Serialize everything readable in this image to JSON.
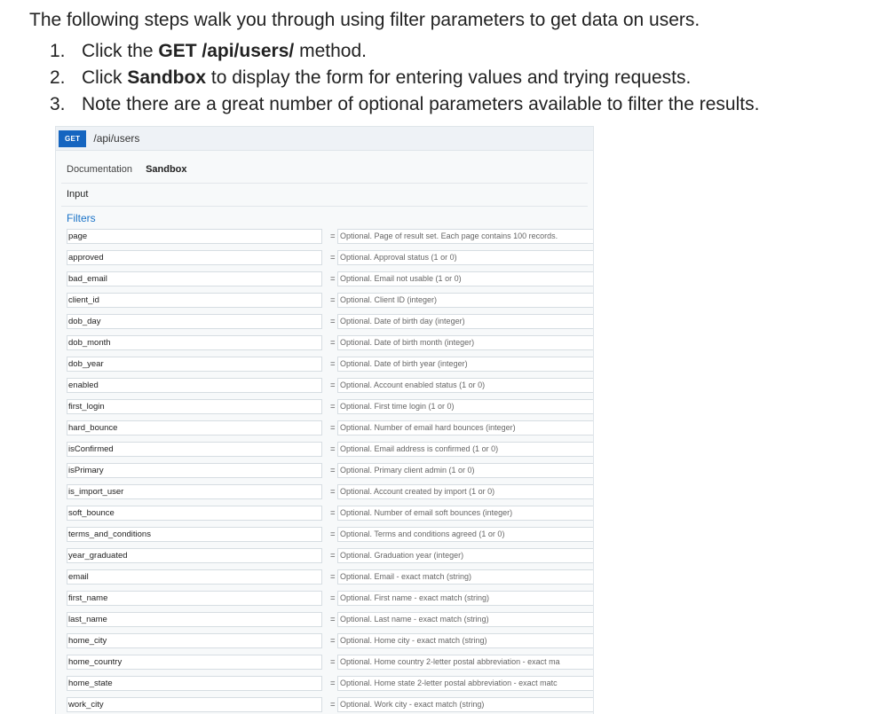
{
  "intro": "The following steps walk you through using filter parameters to get data on users.",
  "steps": [
    {
      "num": "1.",
      "pre": "Click the ",
      "bold": "GET /api/users/",
      "post": " method."
    },
    {
      "num": "2.",
      "pre": "Click ",
      "bold": "Sandbox",
      "post": " to display the form for entering values and trying requests."
    },
    {
      "num": "3.",
      "pre": "Note there are a great number of optional parameters available to filter the results.",
      "bold": "",
      "post": ""
    }
  ],
  "panel": {
    "method": "GET",
    "path": "/api/users",
    "tabs": [
      "Documentation",
      "Sandbox"
    ],
    "input_label": "Input",
    "filters_label": "Filters",
    "eq": "=",
    "dash": "-"
  },
  "filters": [
    {
      "name": "page",
      "desc": "Optional. Page of result set. Each page contains 100 records."
    },
    {
      "name": "approved",
      "desc": "Optional. Approval status (1 or 0)"
    },
    {
      "name": "bad_email",
      "desc": "Optional. Email not usable (1 or 0)"
    },
    {
      "name": "client_id",
      "desc": "Optional. Client ID (integer)"
    },
    {
      "name": "dob_day",
      "desc": "Optional. Date of birth day (integer)"
    },
    {
      "name": "dob_month",
      "desc": "Optional. Date of birth month (integer)"
    },
    {
      "name": "dob_year",
      "desc": "Optional. Date of birth year (integer)"
    },
    {
      "name": "enabled",
      "desc": "Optional. Account enabled status (1 or 0)"
    },
    {
      "name": "first_login",
      "desc": "Optional. First time login (1 or 0)"
    },
    {
      "name": "hard_bounce",
      "desc": "Optional. Number of email hard bounces (integer)"
    },
    {
      "name": "isConfirmed",
      "desc": "Optional. Email address is confirmed (1 or 0)"
    },
    {
      "name": "isPrimary",
      "desc": "Optional. Primary client admin (1 or 0)"
    },
    {
      "name": "is_import_user",
      "desc": "Optional. Account created by import (1 or 0)"
    },
    {
      "name": "soft_bounce",
      "desc": "Optional. Number of email soft bounces (integer)"
    },
    {
      "name": "terms_and_conditions",
      "desc": "Optional. Terms and conditions agreed (1 or 0)"
    },
    {
      "name": "year_graduated",
      "desc": "Optional. Graduation year (integer)"
    },
    {
      "name": "email",
      "desc": "Optional. Email - exact match (string)"
    },
    {
      "name": "first_name",
      "desc": "Optional. First name - exact match (string)"
    },
    {
      "name": "last_name",
      "desc": "Optional. Last name - exact match (string)"
    },
    {
      "name": "home_city",
      "desc": "Optional. Home city - exact match (string)"
    },
    {
      "name": "home_country",
      "desc": "Optional. Home country 2-letter postal abbreviation - exact ma"
    },
    {
      "name": "home_state",
      "desc": "Optional. Home state 2-letter postal abbreviation - exact matc"
    },
    {
      "name": "work_city",
      "desc": "Optional. Work city - exact match (string)"
    }
  ]
}
